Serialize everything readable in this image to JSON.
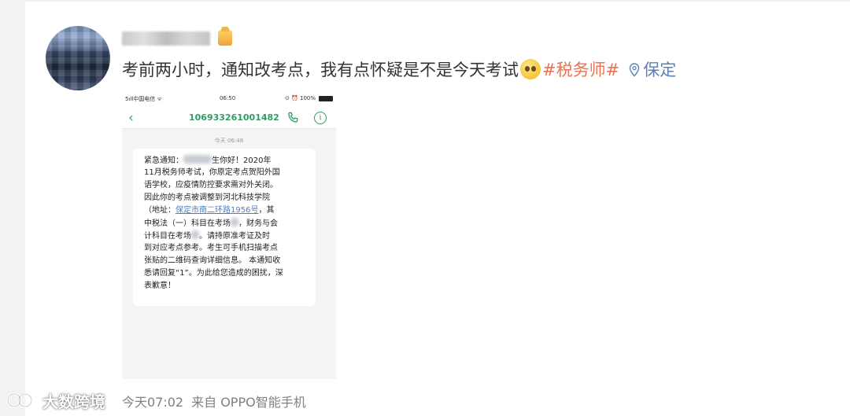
{
  "post": {
    "text": "考前两小时，通知改考点，我有点怀疑是不是今天考试",
    "topic": "#税务师#",
    "location": "保定"
  },
  "sms": {
    "status_carrier": "5ıll中国电信 ᯤ",
    "status_time": "06:50",
    "status_battery": "⊙ ⏰ 100%",
    "sender_number": "106933261001482",
    "date_label": "今天 06:48",
    "lines": [
      "紧急通知：",
      "生你好！2020年",
      "11月税务师考试，你原定考点贺阳外国",
      "语学校，应疫情防控要求需对外关闭。",
      "因此你的考点被调整到河北科技学院",
      "（地址：",
      "保定市南二环路1956号",
      "，其",
      "中税法（一）科目在考场",
      "，财务与会",
      "计科目在考场",
      "。请持原准考证及时",
      "到对应考点参考。考生可手机扫描考点",
      "张贴的二维码查询详细信息。 本通知收",
      "悉请回复“1”。为此给您造成的困扰，深",
      "表歉意！"
    ]
  },
  "footer": {
    "time": "今天07:02",
    "source": "来自 OPPO智能手机"
  },
  "watermark": {
    "text": "大数跨境"
  },
  "colors": {
    "topic": "#eb7350",
    "location": "#5d7fb3",
    "sms_green": "#2e9c63"
  }
}
